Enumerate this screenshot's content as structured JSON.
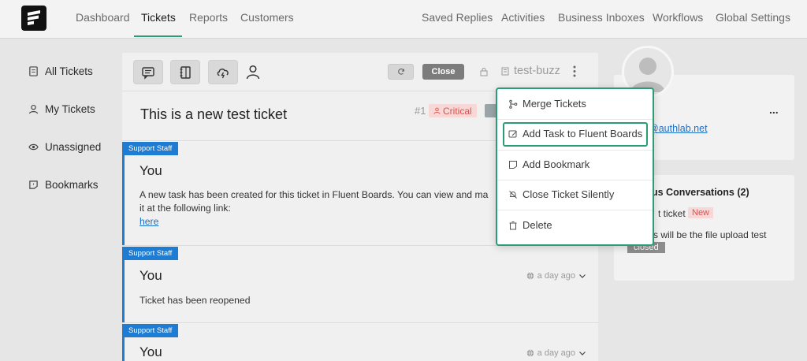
{
  "nav": {
    "left": [
      "Dashboard",
      "Tickets",
      "Reports",
      "Customers"
    ],
    "right": [
      "Saved Replies",
      "Activities",
      "Business Inboxes",
      "Workflows",
      "Global Settings"
    ],
    "active": "Tickets"
  },
  "sidebar": {
    "items": [
      {
        "label": "All Tickets",
        "icon": "document-icon"
      },
      {
        "label": "My Tickets",
        "icon": "user-icon"
      },
      {
        "label": "Unassigned",
        "icon": "eye-icon"
      },
      {
        "label": "Bookmarks",
        "icon": "bookmark-icon"
      }
    ]
  },
  "toolbar": {
    "close_label": "Close",
    "mailbox_name": "test-buzz"
  },
  "ticket": {
    "title": "This is a new test ticket",
    "number": "#1",
    "priority": "Critical"
  },
  "messages": [
    {
      "role": "Support Staff",
      "author": "You",
      "line1": "A new task has been created for this ticket in Fluent Boards. You can view and ma",
      "line2": "it at the following link:",
      "link": "here"
    },
    {
      "role": "Support Staff",
      "author": "You",
      "time": "a day ago",
      "text": "Ticket has been reopened"
    },
    {
      "role": "Support Staff",
      "author": "You",
      "time": "a day ago"
    }
  ],
  "dropdown": {
    "items": [
      {
        "label": "Merge Tickets",
        "icon": "merge-icon"
      },
      {
        "label": "Add Task to Fluent Boards",
        "icon": "task-icon"
      },
      {
        "label": "Add Bookmark",
        "icon": "bookmark-icon"
      },
      {
        "label": "Close Ticket Silently",
        "icon": "bell-off-icon"
      },
      {
        "label": "Delete",
        "icon": "trash-icon"
      }
    ]
  },
  "customer": {
    "email_fragment": "@authlab.net",
    "more": "..."
  },
  "previous": {
    "title_fragment": "us Conversations (2)",
    "item1_fragment": "t ticket",
    "item1_badge": "New",
    "item2_fragment": "s will be the file upload test",
    "item2_badge": "closed"
  },
  "colors": {
    "accent": "#2b9c74",
    "role_badge": "#1f7cd3",
    "critical_bg": "#f8d7d7",
    "critical_text": "#d9534f"
  }
}
